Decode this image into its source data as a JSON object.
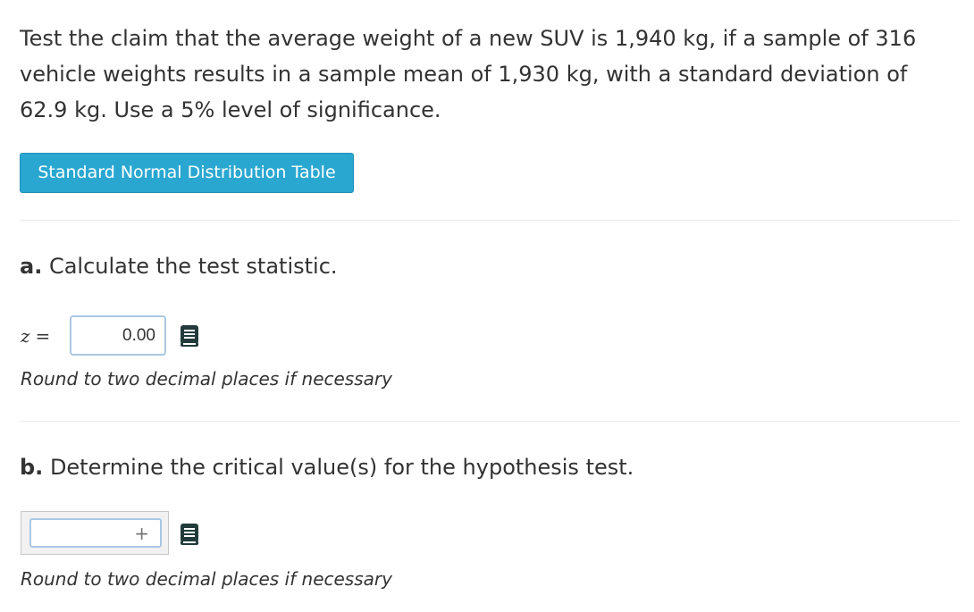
{
  "problem": {
    "text": "Test the claim that the average weight of a new SUV is 1,940 kg, if a sample of 316 vehicle weights results in a sample mean of 1,930 kg, with a standard deviation of 62.9 kg. Use a 5% level of significance."
  },
  "table_button": {
    "label": "Standard Normal Distribution Table"
  },
  "part_a": {
    "letter": "a.",
    "title": "Calculate the test statistic.",
    "variable": "z",
    "equals": "=",
    "input_value": "0.00",
    "hint": "Round to two decimal places if necessary",
    "icon": "book-icon"
  },
  "part_b": {
    "letter": "b.",
    "title": "Determine the critical value(s) for the hypothesis test.",
    "input_value": "",
    "add_symbol": "+",
    "hint": "Round to two decimal places if necessary",
    "icon": "book-icon"
  },
  "colors": {
    "button_bg": "#2aa7d1",
    "input_border": "#a9c7e2",
    "text": "#333333",
    "icon": "#233a3b"
  }
}
